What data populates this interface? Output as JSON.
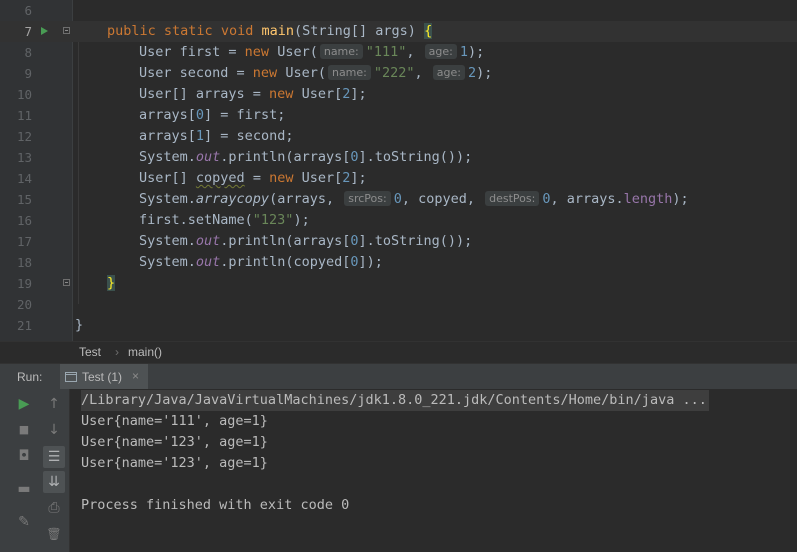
{
  "editor": {
    "lines": [
      {
        "num": "6"
      },
      {
        "num": "7"
      },
      {
        "num": "8"
      },
      {
        "num": "9"
      },
      {
        "num": "10"
      },
      {
        "num": "11"
      },
      {
        "num": "12"
      },
      {
        "num": "13"
      },
      {
        "num": "14"
      },
      {
        "num": "15"
      },
      {
        "num": "16"
      },
      {
        "num": "17"
      },
      {
        "num": "18"
      },
      {
        "num": "19"
      },
      {
        "num": "20"
      },
      {
        "num": "21"
      }
    ],
    "code": {
      "l7": {
        "kw1": "public",
        "kw2": "static",
        "kw3": "void",
        "fn": "main",
        "params": "(String[] args) ",
        "brace": "{"
      },
      "l8": {
        "a": "User first = ",
        "kw": "new",
        "b": " User(",
        "hint1": "name:",
        "str": "\"111\"",
        "c": ", ",
        "hint2": "age:",
        "num": "1",
        "d": ");"
      },
      "l9": {
        "a": "User second = ",
        "kw": "new",
        "b": " User(",
        "hint1": "name:",
        "str": "\"222\"",
        "c": ", ",
        "hint2": "age:",
        "num": "2",
        "d": ");"
      },
      "l10": {
        "a": "User[] arrays = ",
        "kw": "new",
        "b": " User[",
        "num": "2",
        "d": "];"
      },
      "l11": {
        "a": "arrays[",
        "num": "0",
        "b": "] = first;"
      },
      "l12": {
        "a": "arrays[",
        "num": "1",
        "b": "] = second;"
      },
      "l13": {
        "a": "System.",
        "st": "out",
        "b": ".println(arrays[",
        "num": "0",
        "c": "].toString());"
      },
      "l14": {
        "a": "User[] ",
        "wavy": "copyed",
        "b": " = ",
        "kw": "new",
        "c": " User[",
        "num": "2",
        "d": "];"
      },
      "l15": {
        "a": "System.",
        "it": "arraycopy",
        "b": "(arrays, ",
        "hint1": "srcPos:",
        "num1": "0",
        "c": ", copyed, ",
        "hint2": "destPos:",
        "num2": "0",
        "d": ", arrays.",
        "fld": "length",
        "e": ");"
      },
      "l16": {
        "a": "first.setName(",
        "str": "\"123\"",
        "b": ");"
      },
      "l17": {
        "a": "System.",
        "st": "out",
        "b": ".println(arrays[",
        "num": "0",
        "c": "].toString());"
      },
      "l18": {
        "a": "System.",
        "st": "out",
        "b": ".println(copyed[",
        "num": "0",
        "c": "]);"
      },
      "l19": {
        "brace": "}"
      },
      "l21": {
        "brace": "}"
      }
    }
  },
  "breadcrumb": {
    "items": [
      "Test",
      "main()"
    ],
    "separator": "›"
  },
  "run": {
    "label": "Run:",
    "tab": {
      "label": "Test (1)",
      "close": "×"
    },
    "toolbar_left": [
      {
        "icon": "run-icon",
        "glyph": "▶"
      },
      {
        "icon": "stop-icon",
        "glyph": "■"
      },
      {
        "icon": "camera-icon",
        "glyph": "◘"
      },
      {
        "icon": "layout-icon",
        "glyph": "▬"
      },
      {
        "icon": "pin-icon",
        "glyph": "✎"
      }
    ],
    "toolbar_right": [
      {
        "icon": "up-arrow-icon",
        "glyph": "↑"
      },
      {
        "icon": "down-arrow-icon",
        "glyph": "↓"
      },
      {
        "icon": "soft-wrap-icon",
        "glyph": "☰"
      },
      {
        "icon": "scroll-to-end-icon",
        "glyph": "⇊"
      },
      {
        "icon": "print-icon",
        "glyph": "⎙"
      },
      {
        "icon": "trash-icon",
        "glyph": "🗑"
      }
    ],
    "console": [
      "/Library/Java/JavaVirtualMachines/jdk1.8.0_221.jdk/Contents/Home/bin/java ...",
      "User{name='111', age=1}",
      "User{name='123', age=1}",
      "User{name='123', age=1}",
      "",
      "Process finished with exit code 0"
    ]
  },
  "colors": {
    "background": "#2b2b2b",
    "keyword": "#cc7832",
    "string": "#6a8759",
    "number": "#6897bb",
    "method": "#ffc66d",
    "static_field": "#9876aa",
    "run_green": "#499c54"
  }
}
